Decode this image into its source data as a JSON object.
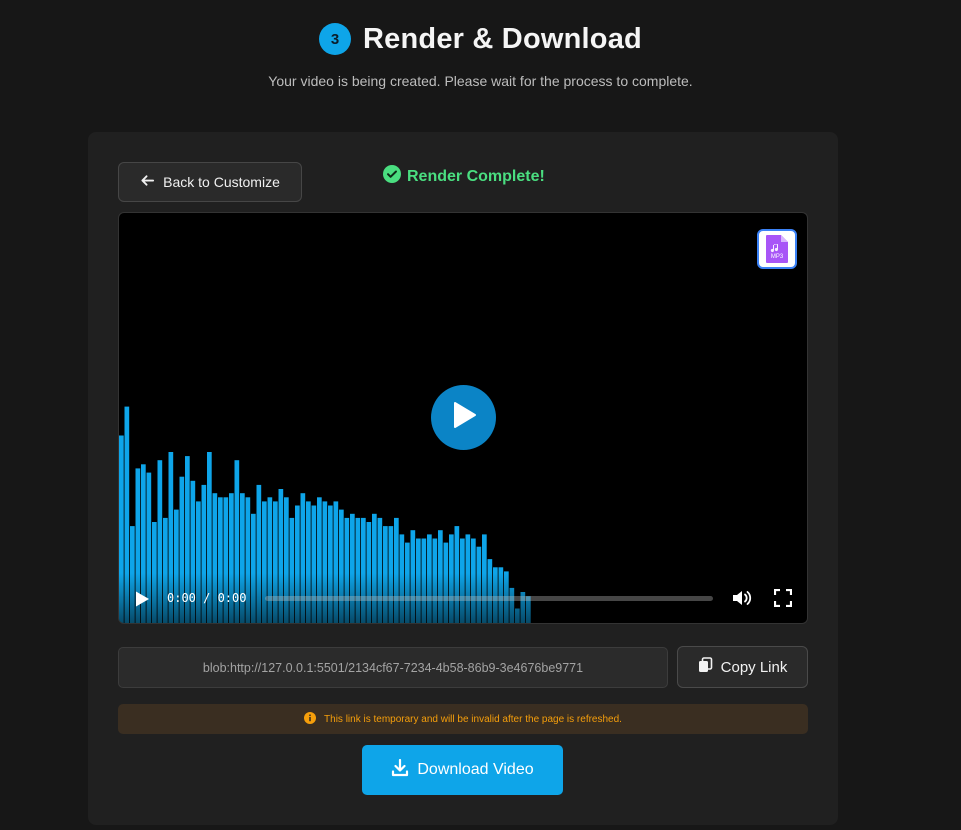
{
  "header": {
    "step_number": "3",
    "title": "Render & Download",
    "subtitle": "Your video is being created. Please wait for the process to complete."
  },
  "card": {
    "back_label": "Back to Customize",
    "status_text": "Render Complete!",
    "status_color": "#4ade80"
  },
  "video": {
    "time_text": "0:00 / 0:00",
    "badge_text": "MP3",
    "progress_fraction": 0.0,
    "bar_color": "#0ea5e9",
    "bar_levels": [
      0.46,
      0.53,
      0.24,
      0.38,
      0.39,
      0.37,
      0.25,
      0.4,
      0.26,
      0.42,
      0.28,
      0.36,
      0.41,
      0.35,
      0.3,
      0.34,
      0.42,
      0.32,
      0.31,
      0.31,
      0.32,
      0.4,
      0.32,
      0.31,
      0.27,
      0.34,
      0.3,
      0.31,
      0.3,
      0.33,
      0.31,
      0.26,
      0.29,
      0.32,
      0.3,
      0.29,
      0.31,
      0.3,
      0.29,
      0.3,
      0.28,
      0.26,
      0.27,
      0.26,
      0.26,
      0.25,
      0.27,
      0.26,
      0.24,
      0.24,
      0.26,
      0.22,
      0.2,
      0.23,
      0.21,
      0.21,
      0.22,
      0.21,
      0.23,
      0.2,
      0.22,
      0.24,
      0.21,
      0.22,
      0.21,
      0.19,
      0.22,
      0.16,
      0.14,
      0.14,
      0.13,
      0.09,
      0.04,
      0.08,
      0.07
    ]
  },
  "share": {
    "link_value": "blob:http://127.0.0.1:5501/2134cf67-7234-4b58-86b9-3e4676be9771",
    "copy_label": "Copy Link",
    "warning_text": "This link is temporary and will be invalid after the page is refreshed.",
    "download_label": "Download Video"
  },
  "colors": {
    "accent": "#0ea5e9",
    "warning": "#f59e0b",
    "background": "#171717",
    "card": "#202020"
  }
}
